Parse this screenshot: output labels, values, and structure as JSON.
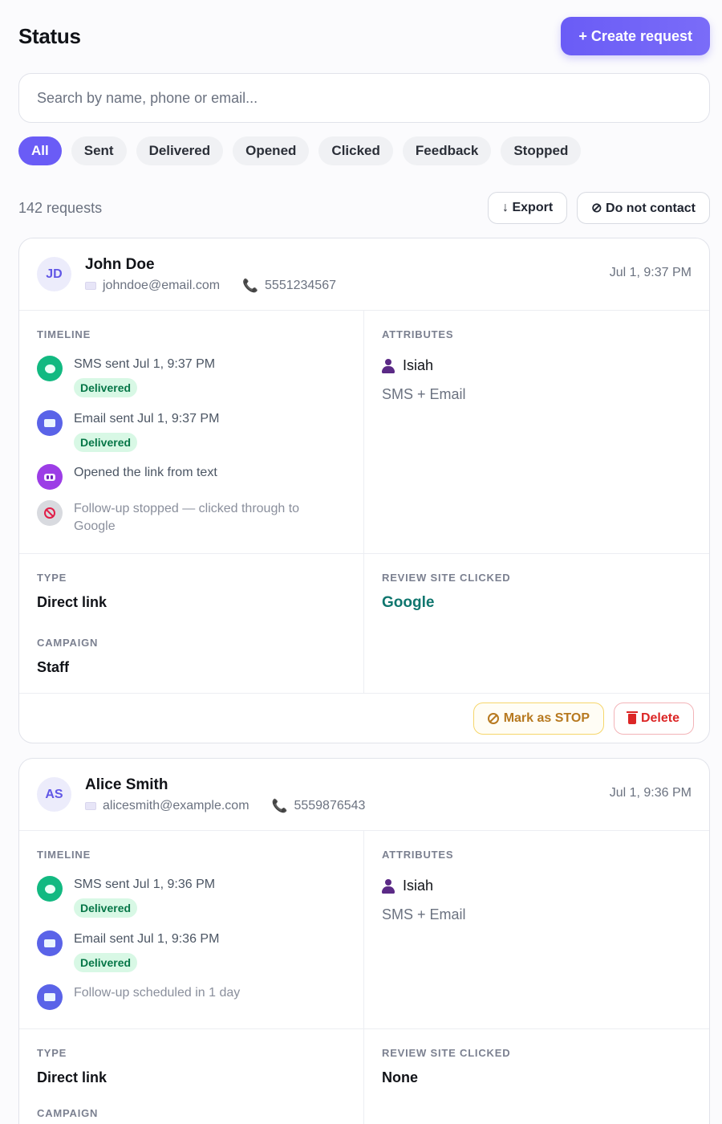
{
  "header": {
    "title": "Status",
    "create_label": "+ Create request"
  },
  "search": {
    "placeholder": "Search by name, phone or email..."
  },
  "filters": [
    "All",
    "Sent",
    "Delivered",
    "Opened",
    "Clicked",
    "Feedback",
    "Stopped"
  ],
  "summary": {
    "count": "142 requests",
    "export_label": "↓ Export",
    "dnc_label": "⊘ Do not contact"
  },
  "labels": {
    "timeline": "TIMELINE",
    "attributes": "ATTRIBUTES",
    "type": "TYPE",
    "review_site": "REVIEW SITE CLICKED",
    "campaign": "CAMPAIGN"
  },
  "cards": [
    {
      "initials": "JD",
      "name": "John Doe",
      "email": "johndoe@email.com",
      "phone": "5551234567",
      "time": "Jul 1, 9:37 PM",
      "timeline": [
        "SMS sent Jul 1, 9:37 PM",
        "Email sent Jul 1, 9:37 PM",
        "Opened the link from text",
        "Follow-up stopped — clicked through to Google"
      ],
      "badge": "Delivered",
      "attribute_person": "Isiah",
      "attribute_channel": "SMS + Email",
      "type": "Direct link",
      "review_site": "Google",
      "campaign": "Staff",
      "stop_label": "Mark as STOP",
      "delete_label": "Delete"
    },
    {
      "initials": "AS",
      "name": "Alice Smith",
      "email": "alicesmith@example.com",
      "phone": "5559876543",
      "time": "Jul 1, 9:36 PM",
      "timeline": [
        "SMS sent Jul 1, 9:36 PM",
        "Email sent Jul 1, 9:36 PM",
        "Follow-up scheduled in 1 day"
      ],
      "badge": "Delivered",
      "attribute_person": "Isiah",
      "attribute_channel": "SMS + Email",
      "type": "Direct link",
      "review_site": "None"
    }
  ]
}
